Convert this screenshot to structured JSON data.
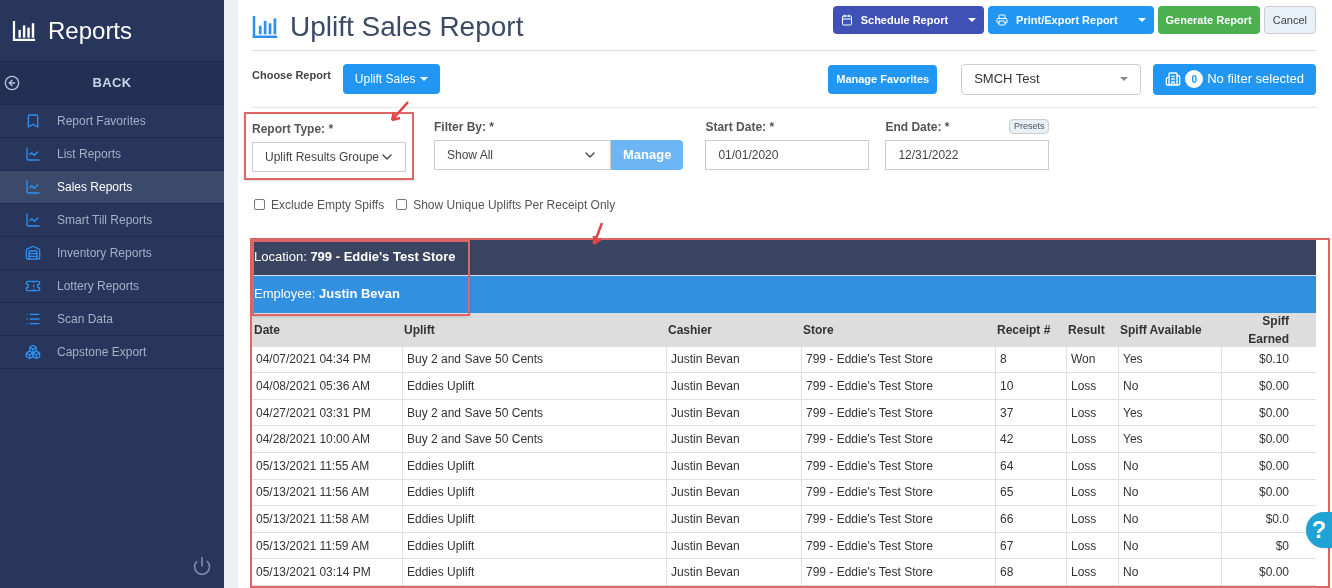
{
  "sidebar": {
    "title": "Reports",
    "back": "BACK",
    "items": [
      {
        "label": "Report Favorites",
        "selected": false
      },
      {
        "label": "List Reports",
        "selected": false
      },
      {
        "label": "Sales Reports",
        "selected": true
      },
      {
        "label": "Smart Till Reports",
        "selected": false
      },
      {
        "label": "Inventory Reports",
        "selected": false
      },
      {
        "label": "Lottery Reports",
        "selected": false
      },
      {
        "label": "Scan Data",
        "selected": false
      },
      {
        "label": "Capstone Export",
        "selected": false
      }
    ]
  },
  "page_title": "Uplift Sales Report",
  "toolbar": {
    "schedule": "Schedule Report",
    "print": "Print/Export Report",
    "generate": "Generate Report",
    "cancel": "Cancel"
  },
  "choose_report": {
    "label": "Choose Report",
    "value": "Uplift Sales",
    "manage_favorites": "Manage Favorites",
    "profile": "SMCH Test",
    "filter_count": "0",
    "filter_label": "No filter selected"
  },
  "form": {
    "report_type": {
      "label": "Report Type: *",
      "value": "Uplift Results Groupe"
    },
    "filter_by": {
      "label": "Filter By: *",
      "value": "Show All",
      "button": "Manage"
    },
    "start_date": {
      "label": "Start Date: *",
      "value": "01/01/2020"
    },
    "end_date": {
      "label": "End Date: *",
      "value": "12/31/2022",
      "presets": "Presets"
    },
    "options": [
      {
        "label": "Exclude Empty Spiffs",
        "checked": false
      },
      {
        "label": "Show Unique Uplifts Per Receipt Only",
        "checked": false
      }
    ]
  },
  "report": {
    "location_label": "Location:",
    "location": "799 - Eddie's Test Store",
    "employee_label": "Employee:",
    "employee": "Justin Bevan",
    "columns": [
      "Date",
      "Uplift",
      "Cashier",
      "Store",
      "Receipt #",
      "Result",
      "Spiff Available",
      "Spiff Earned"
    ],
    "rows": [
      [
        "04/07/2021 04:34 PM",
        "Buy 2 and Save 50 Cents",
        "Justin Bevan",
        "799 - Eddie's Test Store",
        "8",
        "Won",
        "Yes",
        "$0.10"
      ],
      [
        "04/08/2021 05:36 AM",
        "Eddies Uplift",
        "Justin Bevan",
        "799 - Eddie's Test Store",
        "10",
        "Loss",
        "No",
        "$0.00"
      ],
      [
        "04/27/2021 03:31 PM",
        "Buy 2 and Save 50 Cents",
        "Justin Bevan",
        "799 - Eddie's Test Store",
        "37",
        "Loss",
        "Yes",
        "$0.00"
      ],
      [
        "04/28/2021 10:00 AM",
        "Buy 2 and Save 50 Cents",
        "Justin Bevan",
        "799 - Eddie's Test Store",
        "42",
        "Loss",
        "Yes",
        "$0.00"
      ],
      [
        "05/13/2021 11:55 AM",
        "Eddies Uplift",
        "Justin Bevan",
        "799 - Eddie's Test Store",
        "64",
        "Loss",
        "No",
        "$0.00"
      ],
      [
        "05/13/2021 11:56 AM",
        "Eddies Uplift",
        "Justin Bevan",
        "799 - Eddie's Test Store",
        "65",
        "Loss",
        "No",
        "$0.00"
      ],
      [
        "05/13/2021 11:58 AM",
        "Eddies Uplift",
        "Justin Bevan",
        "799 - Eddie's Test Store",
        "66",
        "Loss",
        "No",
        "$0.0"
      ],
      [
        "05/13/2021 11:59 AM",
        "Eddies Uplift",
        "Justin Bevan",
        "799 - Eddie's Test Store",
        "67",
        "Loss",
        "No",
        "$0"
      ],
      [
        "05/13/2021 03:14 PM",
        "Eddies Uplift",
        "Justin Bevan",
        "799 - Eddie's Test Store",
        "68",
        "Loss",
        "No",
        "$0.00"
      ]
    ]
  },
  "help": "?"
}
